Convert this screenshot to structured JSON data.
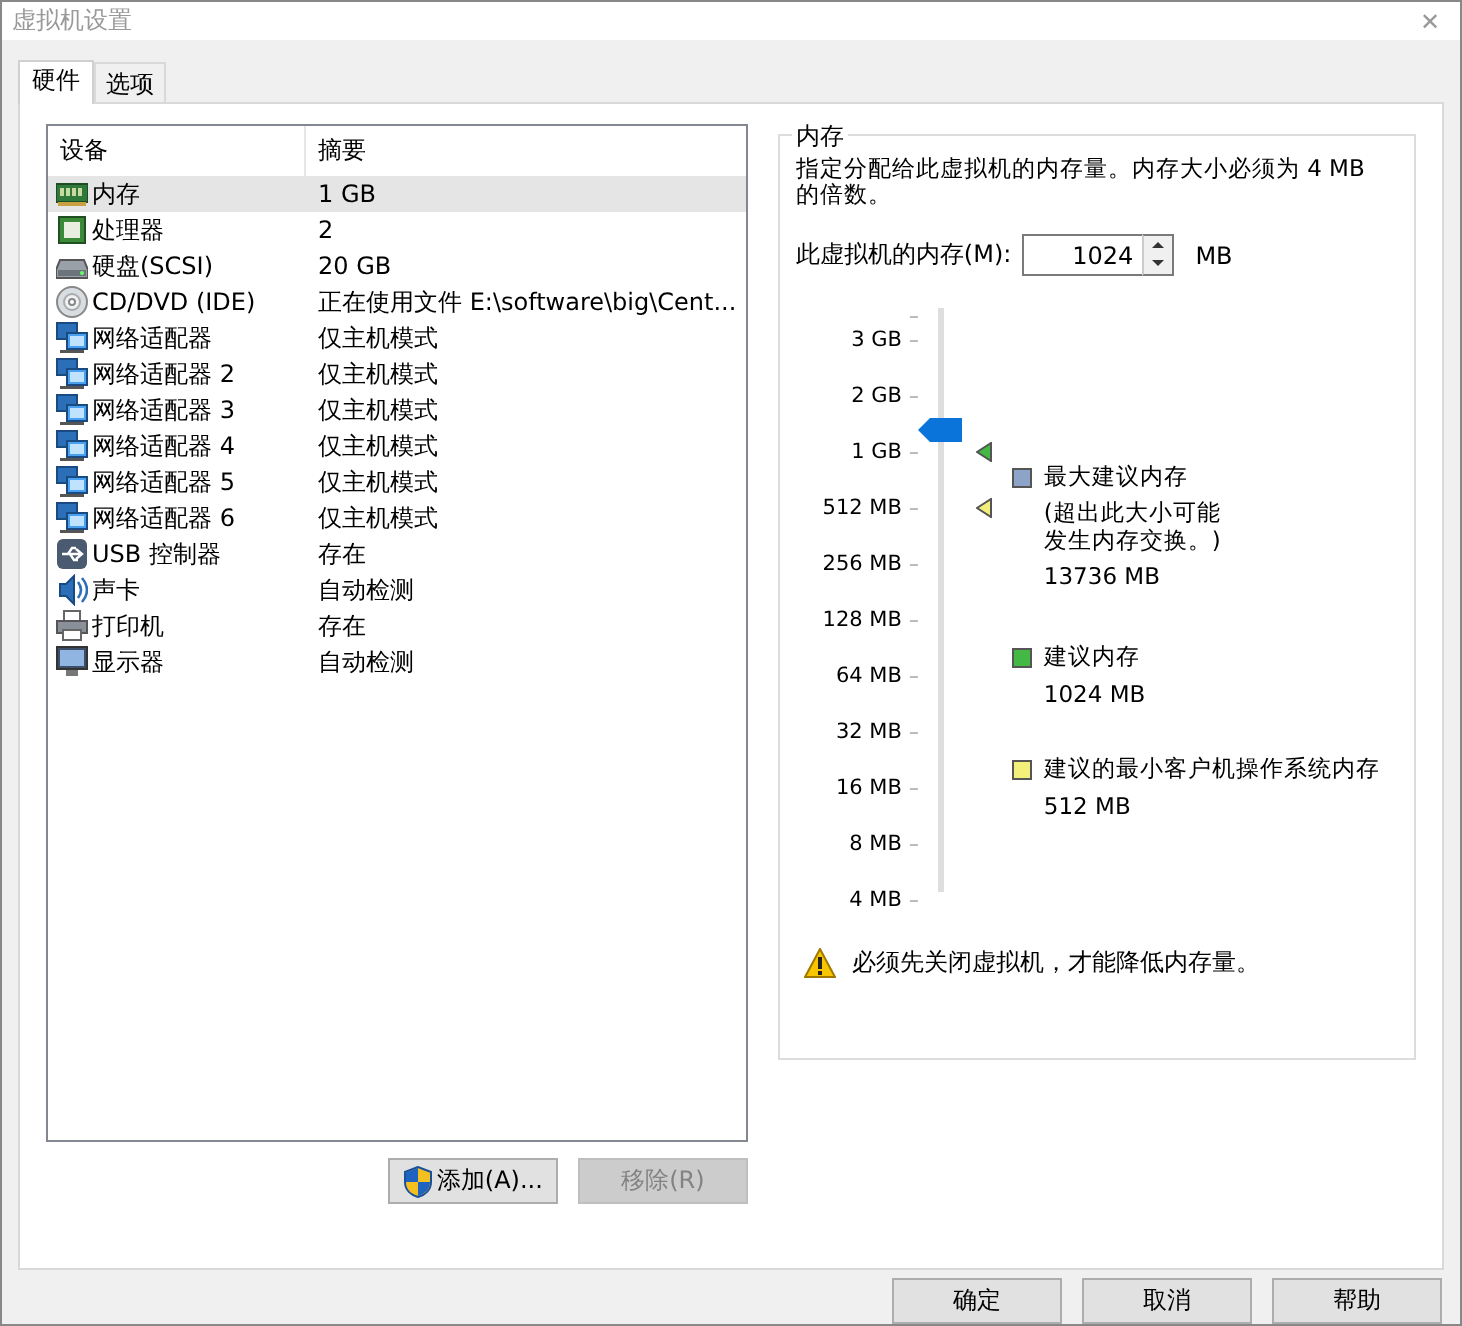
{
  "window": {
    "title": "虚拟机设置",
    "close": "✕"
  },
  "tabs": [
    {
      "label": "硬件",
      "selected": true
    },
    {
      "label": "选项",
      "selected": false
    }
  ],
  "devices": {
    "columns": [
      "设备",
      "摘要"
    ],
    "rows": [
      {
        "kind": "memory",
        "device": "内存",
        "summary": "1 GB",
        "selected": true
      },
      {
        "kind": "cpu",
        "device": "处理器",
        "summary": "2",
        "selected": false
      },
      {
        "kind": "disk",
        "device": "硬盘(SCSI)",
        "summary": "20 GB",
        "selected": false
      },
      {
        "kind": "cd",
        "device": "CD/DVD (IDE)",
        "summary": "正在使用文件 E:\\software\\big\\Cent...",
        "selected": false
      },
      {
        "kind": "network",
        "device": "网络适配器",
        "summary": "仅主机模式",
        "selected": false
      },
      {
        "kind": "network",
        "device": "网络适配器 2",
        "summary": "仅主机模式",
        "selected": false
      },
      {
        "kind": "network",
        "device": "网络适配器 3",
        "summary": "仅主机模式",
        "selected": false
      },
      {
        "kind": "network",
        "device": "网络适配器 4",
        "summary": "仅主机模式",
        "selected": false
      },
      {
        "kind": "network",
        "device": "网络适配器 5",
        "summary": "仅主机模式",
        "selected": false
      },
      {
        "kind": "network",
        "device": "网络适配器 6",
        "summary": "仅主机模式",
        "selected": false
      },
      {
        "kind": "usb",
        "device": "USB 控制器",
        "summary": "存在",
        "selected": false
      },
      {
        "kind": "sound",
        "device": "声卡",
        "summary": "自动检测",
        "selected": false
      },
      {
        "kind": "printer",
        "device": "打印机",
        "summary": "存在",
        "selected": false
      },
      {
        "kind": "display",
        "device": "显示器",
        "summary": "自动检测",
        "selected": false
      }
    ],
    "buttons": [
      {
        "label": "添加(A)...",
        "shield": true,
        "disabled": false
      },
      {
        "label": "移除(R)",
        "shield": false,
        "disabled": true
      }
    ]
  },
  "memory": {
    "title": "内存",
    "description": "指定分配给此虚拟机的内存量。内存大小必须为 4 MB 的倍数。",
    "field_label": "此虚拟机的内存(M):",
    "value": "1024",
    "unit": "MB",
    "slider": {
      "level": 0.79,
      "ticks": [
        {
          "kind": "minor"
        },
        {
          "kind": "major",
          "label": "3 GB"
        },
        {
          "kind": "major",
          "label": "2 GB"
        },
        {
          "kind": "major",
          "label": "1 GB",
          "color": "#44b844"
        },
        {
          "kind": "major",
          "label": "512 MB",
          "color": "#f2f07a"
        },
        {
          "kind": "major",
          "label": "256 MB"
        },
        {
          "kind": "major",
          "label": "128 MB"
        },
        {
          "kind": "major",
          "label": "64 MB"
        },
        {
          "kind": "major",
          "label": "32 MB"
        },
        {
          "kind": "major",
          "label": "16 MB"
        },
        {
          "kind": "major",
          "label": "8 MB"
        },
        {
          "kind": "major",
          "label": "4 MB"
        }
      ]
    },
    "legend": [
      {
        "color": "#8da4c8",
        "title": "最大建议内存",
        "note": "(超出此大小可能发生内存交换。)",
        "value": "13736 MB"
      },
      {
        "color": "#44b844",
        "title": "建议内存",
        "value": "1024 MB"
      },
      {
        "color": "#f2f07a",
        "title": "建议的最小客户机操作系统内存",
        "value": "512 MB"
      }
    ],
    "warning": "必须先关闭虚拟机，才能降低内存量。"
  },
  "footer_buttons": [
    "确定",
    "取消",
    "帮助"
  ]
}
